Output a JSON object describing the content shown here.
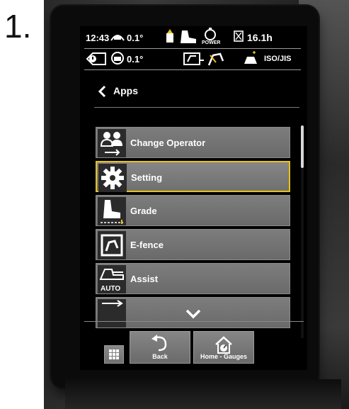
{
  "step": {
    "number": "1."
  },
  "status_bar": {
    "time": "12:43",
    "pitch_value": "0.1°",
    "roll_value": "0.1°",
    "power_label": "POWER",
    "hour_meter": "16.1h",
    "pattern_label": "ISO/JIS"
  },
  "header": {
    "title": "Apps"
  },
  "apps_list": [
    {
      "label": "Change Operator",
      "icon": "change-operator-icon",
      "selected": false
    },
    {
      "label": "Setting",
      "icon": "gear-icon",
      "selected": true
    },
    {
      "label": "Grade",
      "icon": "grade-icon",
      "selected": false
    },
    {
      "label": "E-fence",
      "icon": "e-fence-icon",
      "selected": false
    },
    {
      "label": "Assist",
      "icon": "assist-auto-icon",
      "selected": false,
      "icon_text": "AUTO"
    },
    {
      "label": "",
      "icon": "partial-item-icon",
      "selected": false
    }
  ],
  "bottom_bar": {
    "back_label": "Back",
    "home_label": "Home - Gauges"
  },
  "colors": {
    "selection_border": "#e8c21b",
    "item_background": "#7a7a7a",
    "screen_background": "#000000"
  }
}
